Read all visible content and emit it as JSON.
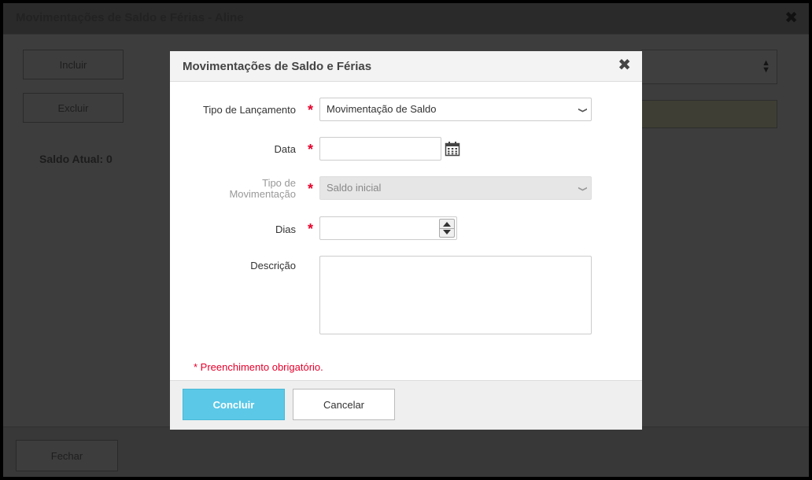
{
  "background": {
    "title": "Movimentações de Saldo e Férias - Aline",
    "close_icon": "close-icon",
    "include_label": "Incluir",
    "exclude_label": "Excluir",
    "saldo_label": "Saldo Atual: 0",
    "close_footer_label": "Fechar"
  },
  "modal": {
    "title": "Movimentações de Saldo e Férias",
    "close_glyph": "✖",
    "required_mark": "*",
    "fields": {
      "tipo_lancamento": {
        "label": "Tipo de Lançamento",
        "value": "Movimentação de Saldo"
      },
      "data": {
        "label": "Data",
        "value": ""
      },
      "tipo_movimentacao": {
        "label_line1": "Tipo de",
        "label_line2": "Movimentação",
        "value": "Saldo inicial",
        "disabled": true
      },
      "dias": {
        "label": "Dias",
        "value": ""
      },
      "descricao": {
        "label": "Descrição",
        "value": ""
      }
    },
    "required_note": "* Preenchimento obrigatório.",
    "buttons": {
      "confirm": "Concluir",
      "cancel": "Cancelar"
    }
  },
  "colors": {
    "primary": "#5bc8e7",
    "required": "#e5002b",
    "overlay": "#3d3d3d"
  }
}
